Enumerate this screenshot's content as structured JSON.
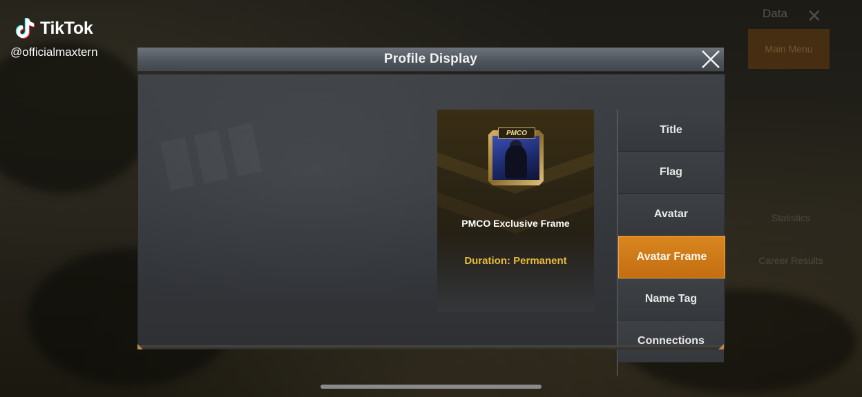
{
  "watermark": {
    "app_name": "TikTok",
    "username": "@officialmaxtern"
  },
  "background": {
    "data_label": "Data",
    "main_menu": "Main Menu",
    "menu_items": [
      "Statistics",
      "Career Results"
    ]
  },
  "dialog": {
    "title": "Profile Display",
    "preview": {
      "frame_badge": "PMCO",
      "item_name": "PMCO Exclusive Frame",
      "duration": "Duration: Permanent"
    },
    "tabs": [
      {
        "label": "Title",
        "active": false
      },
      {
        "label": "Flag",
        "active": false
      },
      {
        "label": "Avatar",
        "active": false
      },
      {
        "label": "Avatar Frame",
        "active": true
      },
      {
        "label": "Name Tag",
        "active": false
      },
      {
        "label": "Connections",
        "active": false
      }
    ]
  },
  "colors": {
    "accent": "#d9861f",
    "duration_text": "#e8b93a"
  }
}
